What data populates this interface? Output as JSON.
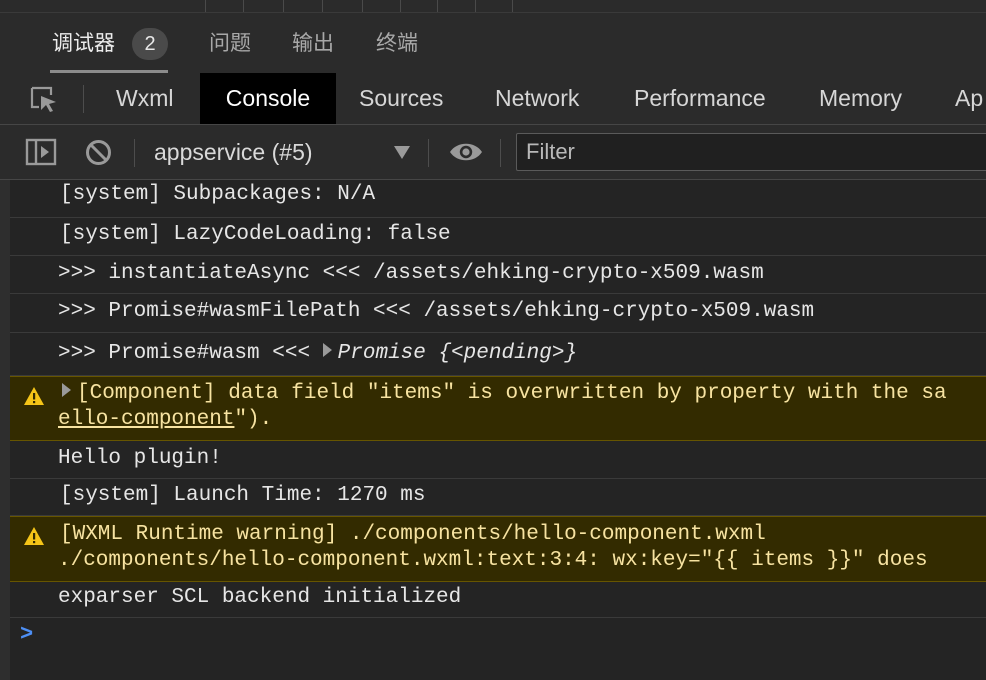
{
  "panel_tabs": [
    {
      "label": "调试器",
      "badge": "2"
    },
    {
      "label": "问题"
    },
    {
      "label": "输出"
    },
    {
      "label": "终端"
    }
  ],
  "devtools_tabs": [
    "Wxml",
    "Console",
    "Sources",
    "Network",
    "Performance",
    "Memory",
    "Ap"
  ],
  "toolbar": {
    "context": "appservice (#5)",
    "filter_placeholder": "Filter"
  },
  "console": {
    "lines": [
      "[system] Subpackages: N/A",
      "[system] LazyCodeLoading: false",
      ">>> instantiateAsync <<< /assets/ehking-crypto-x509.wasm",
      ">>> Promise#wasmFilePath <<< /assets/ehking-crypto-x509.wasm",
      ">>> Promise#wasm <<< ",
      "Promise {<pending>}",
      "[Component] data field \"items\" is overwritten by property with the sa",
      "ello-component",
      "\").",
      "Hello plugin!",
      "[system] Launch Time: 1270 ms",
      "[WXML Runtime warning] ./components/hello-component.wxml",
      "./components/hello-component.wxml:text:3:4: wx:key=\"{{ items }}\" does",
      "exparser SCL backend initialized"
    ]
  },
  "colors": {
    "accent_prompt": "#4d8ff5",
    "warning_bg": "#332b00",
    "warning_icon": "#f5c518"
  }
}
